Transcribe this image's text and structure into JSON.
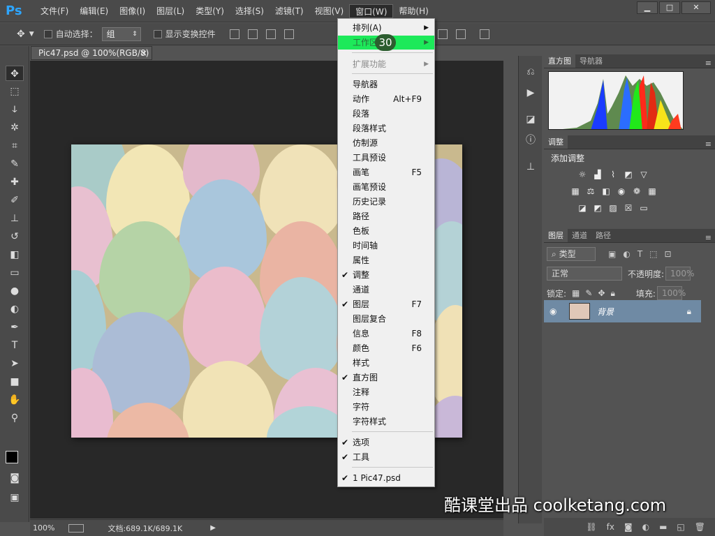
{
  "app": {
    "logo": "Ps"
  },
  "menubar": {
    "items": [
      "文件(F)",
      "编辑(E)",
      "图像(I)",
      "图层(L)",
      "类型(Y)",
      "选择(S)",
      "滤镜(T)",
      "视图(V)",
      "窗口(W)",
      "帮助(H)"
    ],
    "active": "窗口(W)"
  },
  "window_controls": {
    "minimize": "▁",
    "maximize": "□",
    "close": "✕"
  },
  "options_bar": {
    "auto_select_label": "自动选择：",
    "auto_select_value": "组",
    "show_transform_label": "显示变换控件"
  },
  "document": {
    "tab_title": "Pic47.psd @ 100%(RGB/8)",
    "tab_close": "×"
  },
  "status_bar": {
    "zoom": "100%",
    "doc_info": "文档:689.1K/689.1K"
  },
  "window_menu": {
    "items": [
      {
        "label": "排列(A)",
        "submenu": true
      },
      {
        "label": "工作区",
        "submenu": true,
        "highlighted": true
      },
      {
        "label": "扩展功能",
        "submenu": true,
        "disabled": true
      },
      {
        "label": "导航器"
      },
      {
        "label": "动作",
        "shortcut": "Alt+F9"
      },
      {
        "label": "段落"
      },
      {
        "label": "段落样式"
      },
      {
        "label": "仿制源"
      },
      {
        "label": "工具预设"
      },
      {
        "label": "画笔",
        "shortcut": "F5"
      },
      {
        "label": "画笔预设"
      },
      {
        "label": "历史记录"
      },
      {
        "label": "路径"
      },
      {
        "label": "色板"
      },
      {
        "label": "时间轴"
      },
      {
        "label": "属性"
      },
      {
        "label": "调整",
        "checked": true
      },
      {
        "label": "通道"
      },
      {
        "label": "图层",
        "shortcut": "F7",
        "checked": true
      },
      {
        "label": "图层复合"
      },
      {
        "label": "信息",
        "shortcut": "F8"
      },
      {
        "label": "颜色",
        "shortcut": "F6"
      },
      {
        "label": "样式"
      },
      {
        "label": "直方图",
        "checked": true
      },
      {
        "label": "注释"
      },
      {
        "label": "字符"
      },
      {
        "label": "字符样式"
      },
      {
        "label": "选项",
        "checked": true
      },
      {
        "label": "工具",
        "checked": true
      },
      {
        "label": "1 Pic47.psd",
        "checked": true
      }
    ],
    "badge": "30"
  },
  "panels": {
    "histogram": {
      "tabs": [
        "直方图",
        "导航器"
      ]
    },
    "adjustments": {
      "tab": "调整",
      "heading": "添加调整"
    },
    "layers": {
      "tabs": [
        "图层",
        "通道",
        "路径"
      ],
      "filter_kind": "类型",
      "blend_mode": "正常",
      "opacity_label": "不透明度:",
      "opacity_value": "100%",
      "lock_label": "锁定:",
      "fill_label": "填充:",
      "fill_value": "100%",
      "layer_name": "背景"
    }
  },
  "watermark": "酷课堂出品 coolketang.com",
  "colors": {
    "menu_highlight": "#1de95a",
    "badge": "#2c5d2f",
    "ps_blue": "#2ea6ff"
  }
}
